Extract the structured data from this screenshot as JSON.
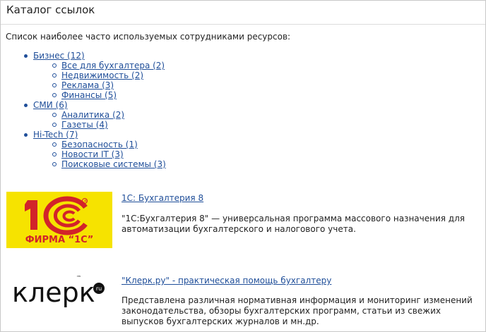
{
  "page": {
    "title": "Каталог ссылок",
    "intro": "Список наиболее часто используемых сотрудниками ресурсов:"
  },
  "categories": [
    {
      "label": "Бизнес (12)",
      "children": [
        "Все для бухгалтера (2)",
        "Недвижимость (2)",
        "Реклама (3)",
        "Финансы (5)"
      ]
    },
    {
      "label": "СМИ (6)",
      "children": [
        "Аналитика (2)",
        "Газеты (4)"
      ]
    },
    {
      "label": "Hi-Tech (7)",
      "children": [
        "Безопасность (1)",
        "Новости IT (3)",
        "Поисковые системы (3)"
      ]
    }
  ],
  "entries": [
    {
      "link": "1С: Бухгалтерия 8",
      "description": "\"1С:Бухгалтерия 8\" — универсальная программа массового назначения для автоматизации бухгалтерского и налогового учета.",
      "logo": {
        "main_text": "1С",
        "sub_text": "ФИРМА “1С”",
        "mark": "®",
        "bg_color": "#f6e300",
        "red": "#d2232a"
      }
    },
    {
      "link": "\"Клерк.ру\" - практическая помощь бухгалтеру",
      "description": "Представлена различная нормативная информация и мониторинг изменений законодательства, обзоры бухгалтерских программ, статьи из свежих выпусков бухгалтерских журналов и мн.др.",
      "logo": {
        "main_text": "клерк",
        "badge": "ru",
        "mark": "™"
      }
    }
  ]
}
